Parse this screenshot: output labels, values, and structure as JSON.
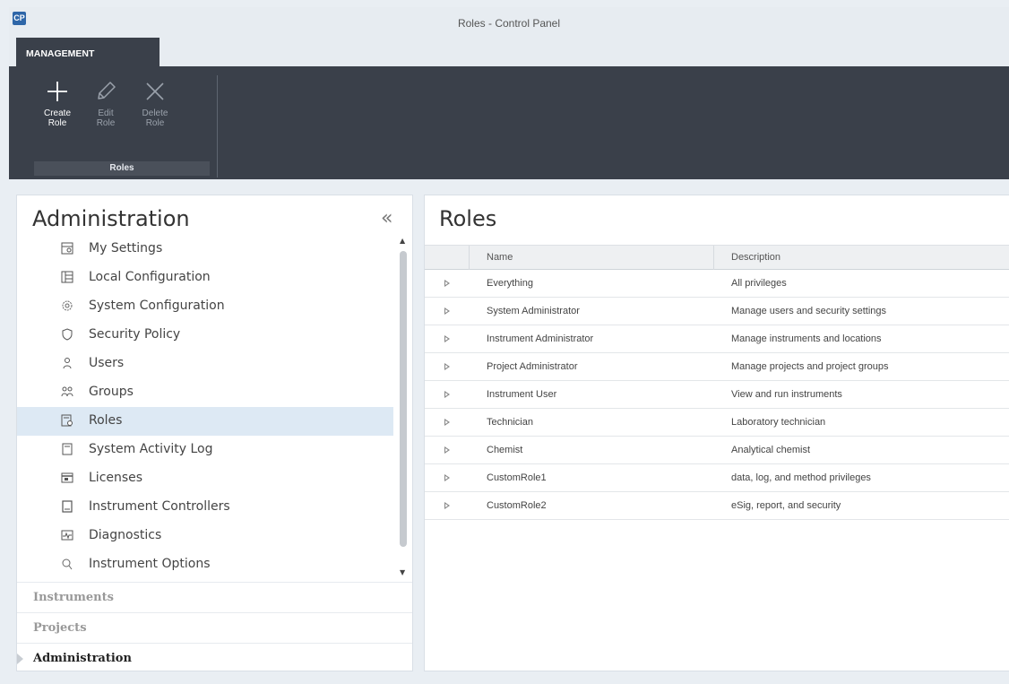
{
  "window": {
    "title": "Roles - Control Panel",
    "logo": "CP"
  },
  "ribbon": {
    "tab": "MANAGEMENT",
    "buttons": [
      {
        "label": "Create\nRole",
        "icon": "plus-icon",
        "enabled": true
      },
      {
        "label": "Edit\nRole",
        "icon": "pencil-icon",
        "enabled": false
      },
      {
        "label": "Delete\nRole",
        "icon": "x-icon",
        "enabled": false
      }
    ],
    "group_label": "Roles"
  },
  "left": {
    "title": "Administration",
    "collapse_icon": "«",
    "items": [
      {
        "label": "My Settings",
        "icon": "my-settings-icon"
      },
      {
        "label": "Local Configuration",
        "icon": "local-configuration-icon"
      },
      {
        "label": "System Configuration",
        "icon": "system-configuration-icon"
      },
      {
        "label": "Security Policy",
        "icon": "shield-icon"
      },
      {
        "label": "Users",
        "icon": "user-icon"
      },
      {
        "label": "Groups",
        "icon": "group-icon"
      },
      {
        "label": "Roles",
        "icon": "roles-icon",
        "selected": true
      },
      {
        "label": "System Activity Log",
        "icon": "log-icon"
      },
      {
        "label": "Licenses",
        "icon": "license-icon"
      },
      {
        "label": "Instrument Controllers",
        "icon": "controller-icon"
      },
      {
        "label": "Diagnostics",
        "icon": "diagnostics-icon"
      },
      {
        "label": "Instrument Options",
        "icon": "options-icon"
      }
    ],
    "sections": [
      {
        "label": "Instruments",
        "active": false
      },
      {
        "label": "Projects",
        "active": false
      },
      {
        "label": "Administration",
        "active": true
      }
    ]
  },
  "right": {
    "title": "Roles",
    "columns": [
      "Name",
      "Description"
    ],
    "rows": [
      {
        "name": "Everything",
        "description": "All privileges"
      },
      {
        "name": "System Administrator",
        "description": "Manage users and security settings"
      },
      {
        "name": "Instrument Administrator",
        "description": "Manage instruments and locations"
      },
      {
        "name": "Project Administrator",
        "description": "Manage projects and project groups"
      },
      {
        "name": "Instrument User",
        "description": "View and run instruments"
      },
      {
        "name": "Technician",
        "description": "Laboratory technician"
      },
      {
        "name": "Chemist",
        "description": "Analytical chemist"
      },
      {
        "name": "CustomRole1",
        "description": "data, log, and method privileges"
      },
      {
        "name": "CustomRole2",
        "description": "eSig, report, and security"
      }
    ]
  },
  "colors": {
    "ribbon_bg": "#3a404a",
    "selected_bg": "#dde9f4",
    "logo": "#2e66a8"
  }
}
